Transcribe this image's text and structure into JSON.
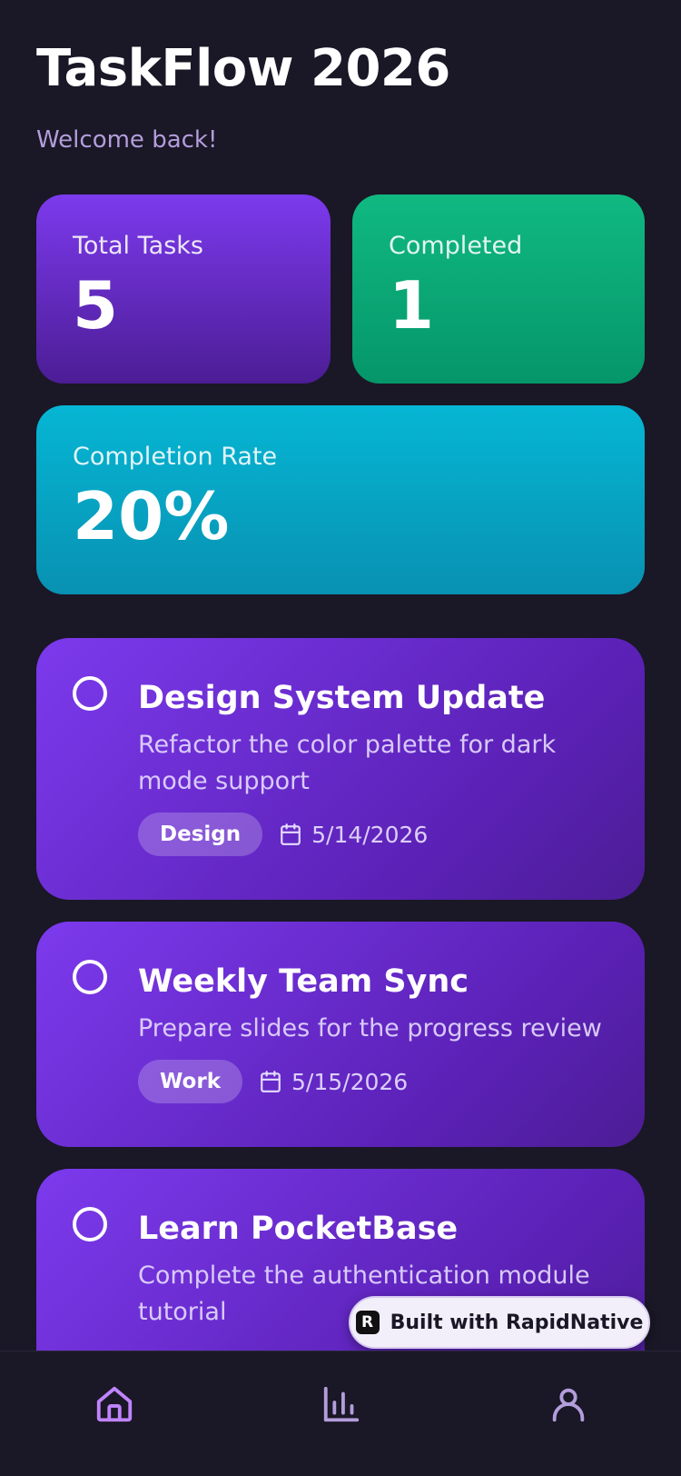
{
  "header": {
    "title": "TaskFlow 2026",
    "subtitle": "Welcome back!"
  },
  "stats": {
    "total": {
      "label": "Total Tasks",
      "value": "5"
    },
    "completed": {
      "label": "Completed",
      "value": "1"
    },
    "rate": {
      "label": "Completion Rate",
      "value": "20%"
    }
  },
  "tasks": [
    {
      "title": "Design System Update",
      "description": "Refactor the color palette for dark mode support",
      "tag": "Design",
      "date": "5/14/2026",
      "completed": false
    },
    {
      "title": "Weekly Team Sync",
      "description": "Prepare slides for the progress review",
      "tag": "Work",
      "date": "5/15/2026",
      "completed": false
    },
    {
      "title": "Learn PocketBase",
      "description": "Complete the authentication module tutorial",
      "completed": false
    }
  ],
  "badge": {
    "logo": "R",
    "label": "Built with RapidNative"
  },
  "nav": {
    "items": [
      {
        "icon": "home-icon",
        "active": true
      },
      {
        "icon": "bar-chart-icon",
        "active": false
      },
      {
        "icon": "user-icon",
        "active": false
      }
    ]
  },
  "colors": {
    "background": "#1a1726",
    "accent": "#7c3aed",
    "success": "#10b981",
    "info": "#06b6d4",
    "nav_active": "#c084fc",
    "nav_inactive": "#b39ddb"
  }
}
